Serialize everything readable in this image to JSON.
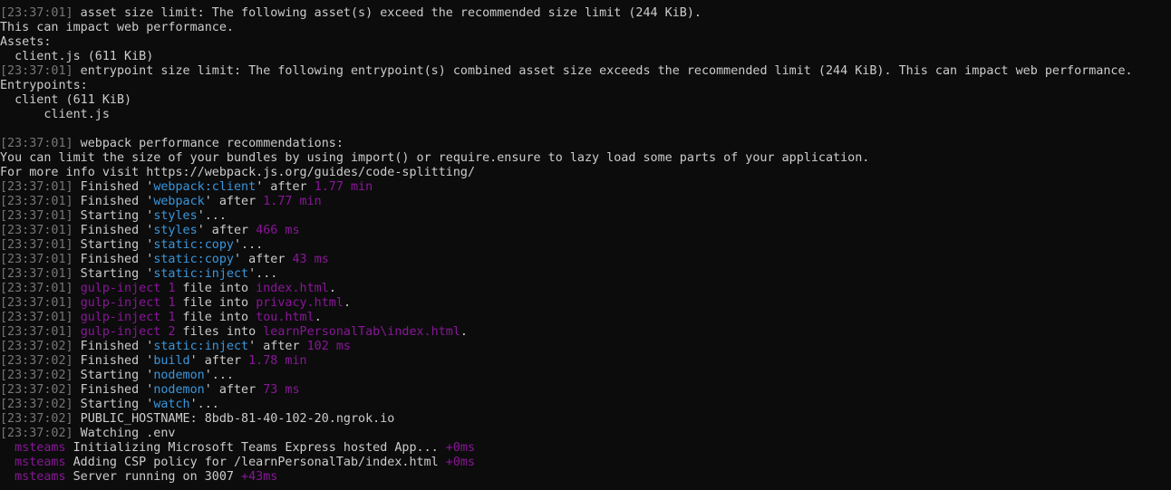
{
  "window": {
    "title": ""
  },
  "colors": {
    "background": "#0c0c0c",
    "text": "#cccccc",
    "timestamp": "#767676",
    "task": "#3a96dd",
    "time": "#881798",
    "plugin": "#881798"
  },
  "lines": [
    {
      "segments": [
        {
          "t": "[23:37:01]",
          "c": "ts"
        },
        {
          "t": " asset size limit: The following asset(s) exceed the recommended size limit (244 KiB).",
          "c": "white"
        }
      ]
    },
    {
      "segments": [
        {
          "t": "This can impact web performance.",
          "c": "white"
        }
      ]
    },
    {
      "segments": [
        {
          "t": "Assets:",
          "c": "white"
        }
      ]
    },
    {
      "segments": [
        {
          "t": "  client.js (611 KiB)",
          "c": "white"
        }
      ]
    },
    {
      "segments": [
        {
          "t": "[23:37:01]",
          "c": "ts"
        },
        {
          "t": " entrypoint size limit: The following entrypoint(s) combined asset size exceeds the recommended limit (244 KiB). This can impact web performance.",
          "c": "white"
        }
      ]
    },
    {
      "segments": [
        {
          "t": "Entrypoints:",
          "c": "white"
        }
      ]
    },
    {
      "segments": [
        {
          "t": "  client (611 KiB)",
          "c": "white"
        }
      ]
    },
    {
      "segments": [
        {
          "t": "      client.js",
          "c": "white"
        }
      ]
    },
    {
      "segments": [
        {
          "t": "",
          "c": "white"
        }
      ]
    },
    {
      "segments": [
        {
          "t": "[23:37:01]",
          "c": "ts"
        },
        {
          "t": " webpack performance recommendations:",
          "c": "white"
        }
      ]
    },
    {
      "segments": [
        {
          "t": "You can limit the size of your bundles by using import() or require.ensure to lazy load some parts of your application.",
          "c": "white"
        }
      ]
    },
    {
      "segments": [
        {
          "t": "For more info visit https://webpack.js.org/guides/code-splitting/",
          "c": "white"
        }
      ]
    },
    {
      "segments": [
        {
          "t": "[23:37:01]",
          "c": "ts"
        },
        {
          "t": " Finished '",
          "c": "white"
        },
        {
          "t": "webpack:client",
          "c": "blue"
        },
        {
          "t": "' after ",
          "c": "white"
        },
        {
          "t": "1.77 min",
          "c": "mag"
        }
      ]
    },
    {
      "segments": [
        {
          "t": "[23:37:01]",
          "c": "ts"
        },
        {
          "t": " Finished '",
          "c": "white"
        },
        {
          "t": "webpack",
          "c": "blue"
        },
        {
          "t": "' after ",
          "c": "white"
        },
        {
          "t": "1.77 min",
          "c": "mag"
        }
      ]
    },
    {
      "segments": [
        {
          "t": "[23:37:01]",
          "c": "ts"
        },
        {
          "t": " Starting '",
          "c": "white"
        },
        {
          "t": "styles",
          "c": "blue"
        },
        {
          "t": "'...",
          "c": "white"
        }
      ]
    },
    {
      "segments": [
        {
          "t": "[23:37:01]",
          "c": "ts"
        },
        {
          "t": " Finished '",
          "c": "white"
        },
        {
          "t": "styles",
          "c": "blue"
        },
        {
          "t": "' after ",
          "c": "white"
        },
        {
          "t": "466 ms",
          "c": "mag"
        }
      ]
    },
    {
      "segments": [
        {
          "t": "[23:37:01]",
          "c": "ts"
        },
        {
          "t": " Starting '",
          "c": "white"
        },
        {
          "t": "static:copy",
          "c": "blue"
        },
        {
          "t": "'...",
          "c": "white"
        }
      ]
    },
    {
      "segments": [
        {
          "t": "[23:37:01]",
          "c": "ts"
        },
        {
          "t": " Finished '",
          "c": "white"
        },
        {
          "t": "static:copy",
          "c": "blue"
        },
        {
          "t": "' after ",
          "c": "white"
        },
        {
          "t": "43 ms",
          "c": "mag"
        }
      ]
    },
    {
      "segments": [
        {
          "t": "[23:37:01]",
          "c": "ts"
        },
        {
          "t": " Starting '",
          "c": "white"
        },
        {
          "t": "static:inject",
          "c": "blue"
        },
        {
          "t": "'...",
          "c": "white"
        }
      ]
    },
    {
      "segments": [
        {
          "t": "[23:37:01]",
          "c": "ts"
        },
        {
          "t": " ",
          "c": "white"
        },
        {
          "t": "gulp-inject",
          "c": "mag"
        },
        {
          "t": " ",
          "c": "white"
        },
        {
          "t": "1",
          "c": "mag"
        },
        {
          "t": " file into ",
          "c": "white"
        },
        {
          "t": "index.html",
          "c": "mag"
        },
        {
          "t": ".",
          "c": "white"
        }
      ]
    },
    {
      "segments": [
        {
          "t": "[23:37:01]",
          "c": "ts"
        },
        {
          "t": " ",
          "c": "white"
        },
        {
          "t": "gulp-inject",
          "c": "mag"
        },
        {
          "t": " ",
          "c": "white"
        },
        {
          "t": "1",
          "c": "mag"
        },
        {
          "t": " file into ",
          "c": "white"
        },
        {
          "t": "privacy.html",
          "c": "mag"
        },
        {
          "t": ".",
          "c": "white"
        }
      ]
    },
    {
      "segments": [
        {
          "t": "[23:37:01]",
          "c": "ts"
        },
        {
          "t": " ",
          "c": "white"
        },
        {
          "t": "gulp-inject",
          "c": "mag"
        },
        {
          "t": " ",
          "c": "white"
        },
        {
          "t": "1",
          "c": "mag"
        },
        {
          "t": " file into ",
          "c": "white"
        },
        {
          "t": "tou.html",
          "c": "mag"
        },
        {
          "t": ".",
          "c": "white"
        }
      ]
    },
    {
      "segments": [
        {
          "t": "[23:37:01]",
          "c": "ts"
        },
        {
          "t": " ",
          "c": "white"
        },
        {
          "t": "gulp-inject",
          "c": "mag"
        },
        {
          "t": " ",
          "c": "white"
        },
        {
          "t": "2",
          "c": "mag"
        },
        {
          "t": " files into ",
          "c": "white"
        },
        {
          "t": "learnPersonalTab\\index.html",
          "c": "mag"
        },
        {
          "t": ".",
          "c": "white"
        }
      ]
    },
    {
      "segments": [
        {
          "t": "[23:37:02]",
          "c": "ts"
        },
        {
          "t": " Finished '",
          "c": "white"
        },
        {
          "t": "static:inject",
          "c": "blue"
        },
        {
          "t": "' after ",
          "c": "white"
        },
        {
          "t": "102 ms",
          "c": "mag"
        }
      ]
    },
    {
      "segments": [
        {
          "t": "[23:37:02]",
          "c": "ts"
        },
        {
          "t": " Finished '",
          "c": "white"
        },
        {
          "t": "build",
          "c": "blue"
        },
        {
          "t": "' after ",
          "c": "white"
        },
        {
          "t": "1.78 min",
          "c": "mag"
        }
      ]
    },
    {
      "segments": [
        {
          "t": "[23:37:02]",
          "c": "ts"
        },
        {
          "t": " Starting '",
          "c": "white"
        },
        {
          "t": "nodemon",
          "c": "blue"
        },
        {
          "t": "'...",
          "c": "white"
        }
      ]
    },
    {
      "segments": [
        {
          "t": "[23:37:02]",
          "c": "ts"
        },
        {
          "t": " Finished '",
          "c": "white"
        },
        {
          "t": "nodemon",
          "c": "blue"
        },
        {
          "t": "' after ",
          "c": "white"
        },
        {
          "t": "73 ms",
          "c": "mag"
        }
      ]
    },
    {
      "segments": [
        {
          "t": "[23:37:02]",
          "c": "ts"
        },
        {
          "t": " Starting '",
          "c": "white"
        },
        {
          "t": "watch",
          "c": "blue"
        },
        {
          "t": "'...",
          "c": "white"
        }
      ]
    },
    {
      "segments": [
        {
          "t": "[23:37:02]",
          "c": "ts"
        },
        {
          "t": " PUBLIC_HOSTNAME: 8bdb-81-40-102-20.ngrok.io",
          "c": "white"
        }
      ]
    },
    {
      "segments": [
        {
          "t": "[23:37:02]",
          "c": "ts"
        },
        {
          "t": " Watching .env",
          "c": "white"
        }
      ]
    },
    {
      "segments": [
        {
          "t": "  ",
          "c": "white"
        },
        {
          "t": "msteams",
          "c": "mag"
        },
        {
          "t": " Initializing Microsoft Teams Express hosted App... ",
          "c": "white"
        },
        {
          "t": "+0ms",
          "c": "mag"
        }
      ]
    },
    {
      "segments": [
        {
          "t": "  ",
          "c": "white"
        },
        {
          "t": "msteams",
          "c": "mag"
        },
        {
          "t": " Adding CSP policy for /learnPersonalTab/index.html ",
          "c": "white"
        },
        {
          "t": "+0ms",
          "c": "mag"
        }
      ]
    },
    {
      "segments": [
        {
          "t": "  ",
          "c": "white"
        },
        {
          "t": "msteams",
          "c": "mag"
        },
        {
          "t": " Server running on 3007 ",
          "c": "white"
        },
        {
          "t": "+43ms",
          "c": "mag"
        }
      ]
    }
  ]
}
